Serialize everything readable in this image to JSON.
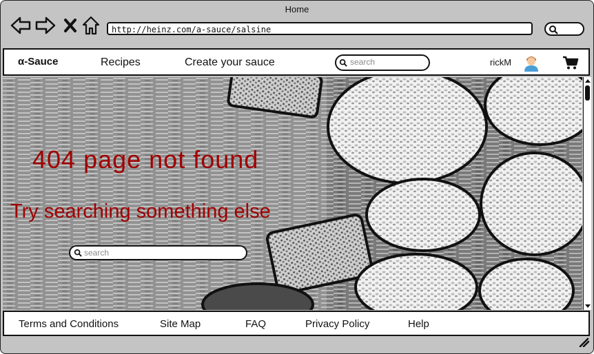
{
  "window": {
    "title": "Home"
  },
  "browser": {
    "url": "http://heinz.com/a-sauce/salsine",
    "icons": [
      "back-arrow-icon",
      "forward-arrow-icon",
      "close-icon",
      "home-icon",
      "search-icon"
    ]
  },
  "header": {
    "logo": "α-Sauce",
    "nav": [
      "Recipes",
      "Create your sauce"
    ],
    "search_placeholder": "search",
    "username": "rickM"
  },
  "main": {
    "error_title": "404 page not found",
    "error_hint": "Try searching something else",
    "search_placeholder": "search"
  },
  "footer": {
    "links": [
      "Terms and Conditions",
      "Site Map",
      "FAQ",
      "Privacy Policy",
      "Help"
    ]
  },
  "colors": {
    "error_text": "#a10000",
    "frame": "#c4c4c4"
  }
}
